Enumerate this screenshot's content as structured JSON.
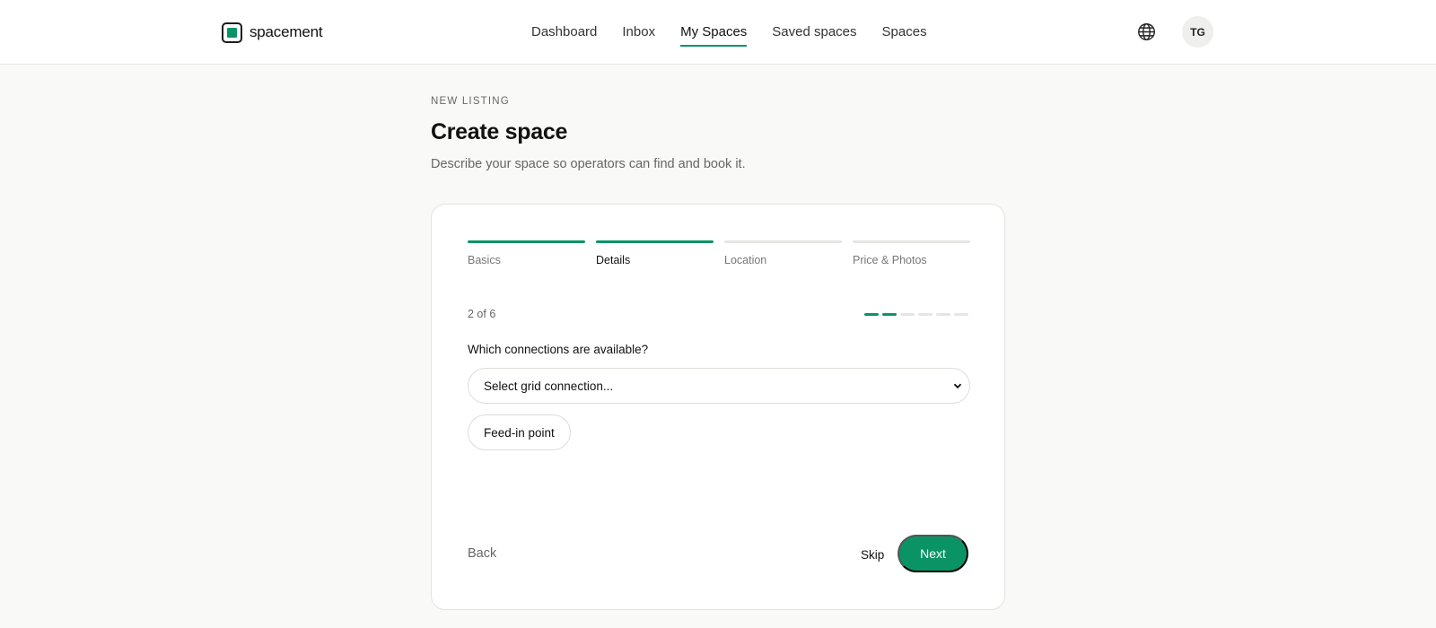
{
  "brand": {
    "name": "spacement"
  },
  "nav": {
    "items": [
      {
        "label": "Dashboard",
        "active": false
      },
      {
        "label": "Inbox",
        "active": false
      },
      {
        "label": "My Spaces",
        "active": true
      },
      {
        "label": "Saved spaces",
        "active": false
      },
      {
        "label": "Spaces",
        "active": false
      }
    ]
  },
  "user": {
    "initials": "TG"
  },
  "page": {
    "eyebrow": "NEW LISTING",
    "title": "Create space",
    "subtitle": "Describe your space so operators can find and book it."
  },
  "wizard": {
    "steps": [
      {
        "label": "Basics",
        "completed": true,
        "current": false
      },
      {
        "label": "Details",
        "completed": true,
        "current": true
      },
      {
        "label": "Location",
        "completed": false,
        "current": false
      },
      {
        "label": "Price & Photos",
        "completed": false,
        "current": false
      }
    ],
    "counter": "2 of 6",
    "progress": {
      "current": 2,
      "total": 6
    },
    "question": "Which connections are available?",
    "select": {
      "value": "Select grid connection..."
    },
    "chip": "Feed-in point",
    "back_label": "Back",
    "skip_label": "Skip",
    "next_label": "Next"
  },
  "colors": {
    "accent": "#0a9466",
    "background": "#f9f9f8",
    "card": "#ffffff",
    "inactive": "#e5e5e3"
  },
  "icons": {
    "logo": "square-logo-icon",
    "language": "globe-icon",
    "dropdown": "chevron-down-icon"
  }
}
